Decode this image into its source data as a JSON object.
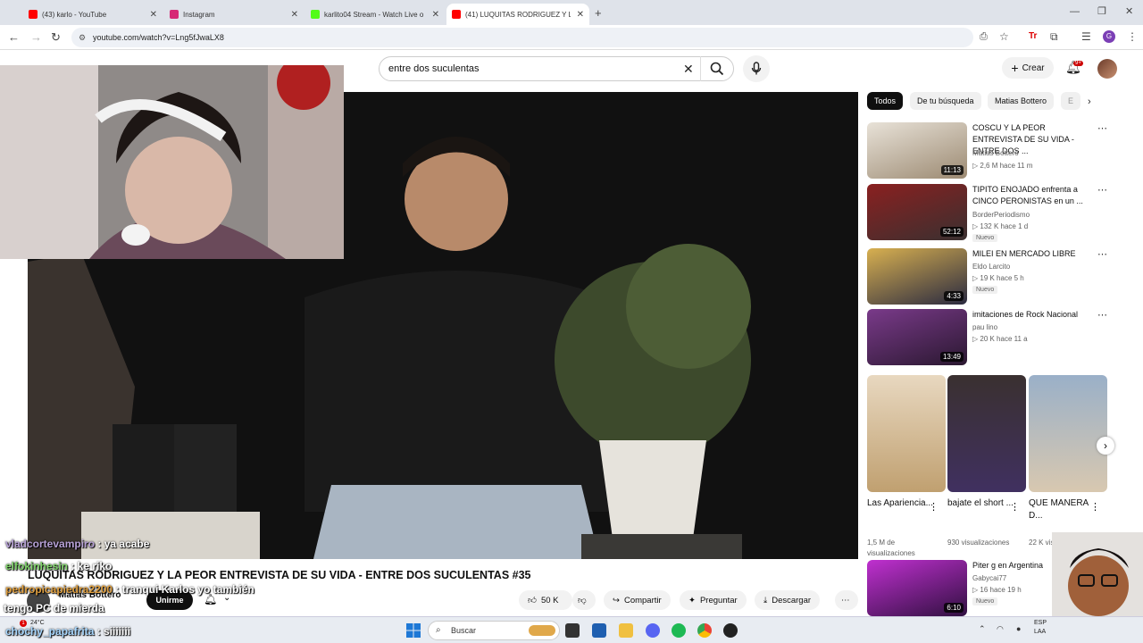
{
  "browser": {
    "tabs": [
      {
        "label": "(43) karlo - YouTube",
        "favicon": "youtube-icon",
        "color": "#ff0000"
      },
      {
        "label": "Instagram",
        "favicon": "instagram-icon",
        "color": "#d62976"
      },
      {
        "label": "karlito04 Stream - Watch Live o",
        "favicon": "kick-icon",
        "color": "#53fc18"
      },
      {
        "label": "(41) LUQUITAS RODRIGUEZ Y L",
        "favicon": "youtube-icon",
        "color": "#ff0000"
      }
    ],
    "url": "youtube.com/watch?v=Lng5fJwaLX8"
  },
  "youtube": {
    "search_query": "entre dos suculentas",
    "create_label": "Crear",
    "notifications_badge": "9+",
    "chips": [
      "Todos",
      "De tu búsqueda",
      "Matias Bottero",
      "E"
    ],
    "recommendations": [
      {
        "title": "COSCU Y LA PEOR ENTREVISTA DE SU VIDA - ENTRE DOS ...",
        "channel": "Matias Bottero",
        "stats": "▷ 2,6 M   hace 11 m",
        "duration": "11:13",
        "badge": ""
      },
      {
        "title": "TIPITO ENOJADO enfrenta a CINCO PERONISTAS en un ...",
        "channel": "BorderPeriodismo",
        "stats": "▷ 132 K   hace 1 d",
        "duration": "52:12",
        "badge": "Nuevo"
      },
      {
        "title": "MILEI EN MERCADO LIBRE",
        "channel": "Eldo Larcito",
        "stats": "▷ 19 K   hace 5 h",
        "duration": "4:33",
        "badge": "Nuevo"
      },
      {
        "title": "imitaciones de Rock Nacional",
        "channel": "pau lino",
        "stats": "▷ 20 K   hace 11 a",
        "duration": "13:49",
        "badge": ""
      }
    ],
    "shorts": [
      {
        "title": "Las Apariencia...",
        "views": "1,5 M de visualizaciones"
      },
      {
        "title": "bajate el short ...",
        "views": "930 visualizaciones"
      },
      {
        "title": "QUE MANERA D...",
        "views": "22 K visuali"
      }
    ],
    "last_rec": {
      "title": "Piter g en Argentina",
      "channel": "Gabycai77",
      "stats": "▷ 16   hace 19 h",
      "duration": "6:10",
      "badge": "Nuevo"
    },
    "video_title": "LUQUITAS RODRIGUEZ Y LA PEOR ENTREVISTA DE SU VIDA - ENTRE DOS SUCULENTAS #35",
    "channel_name": "Matias Bottero",
    "join_label": "Unirme",
    "likes": "50 K",
    "share_label": "Compartir",
    "ask_label": "Preguntar",
    "download_label": "Descargar"
  },
  "chat": [
    {
      "user": "vladcortevampiro",
      "msg": " : ya acabe",
      "color": "#b7a1d6"
    },
    {
      "user": "elfokinhesin",
      "msg": " : ke riko",
      "color": "#7fd36a"
    },
    {
      "user": "pedropicapiedra2200",
      "msg": " : tranqui Karlos yo también",
      "color": "#e0a040"
    },
    {
      "user": "tengo PC de mierda",
      "msg": "",
      "color": "#ffffff"
    },
    {
      "user": "chochy_papafrita",
      "msg": " : siiiiiii",
      "color": "#a8d8ff"
    }
  ],
  "taskbar": {
    "weather": "24°C",
    "search_label": "Buscar",
    "lang": "ESP",
    "lang2": "LAA"
  }
}
